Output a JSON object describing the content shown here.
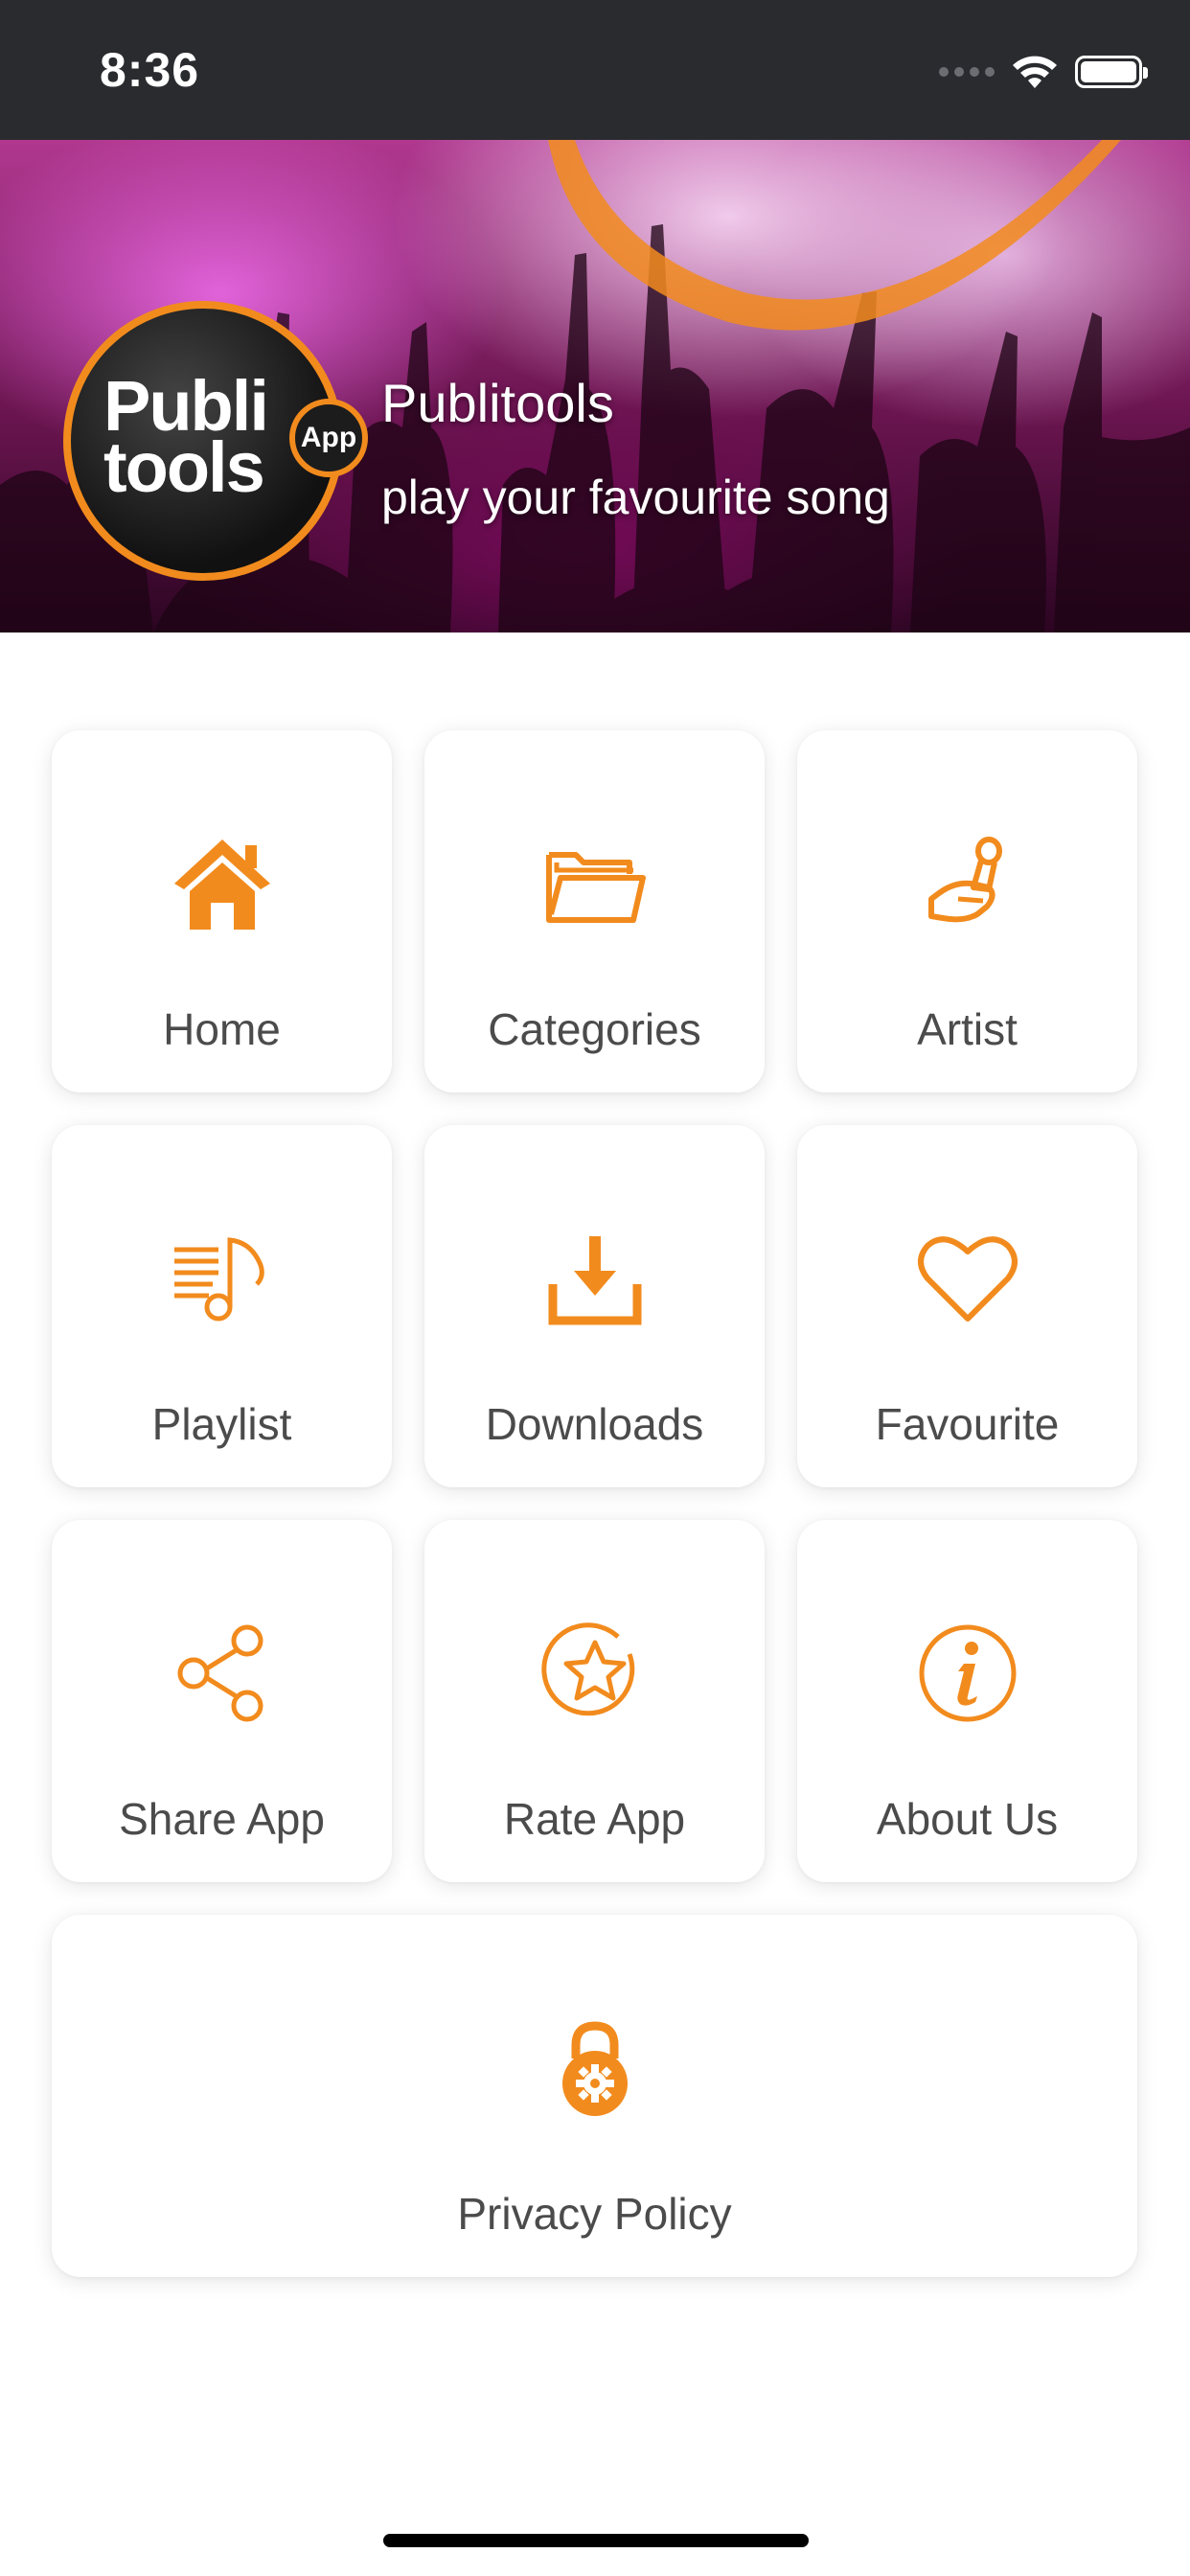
{
  "status_bar": {
    "time": "8:36"
  },
  "header": {
    "logo_text_line1": "Publi",
    "logo_text_line2": "tools",
    "logo_badge": "App",
    "title": "Publitools",
    "subtitle": "play your favourite song"
  },
  "menu": {
    "items": [
      {
        "label": "Home",
        "icon": "home-icon"
      },
      {
        "label": "Categories",
        "icon": "folder-icon"
      },
      {
        "label": "Artist",
        "icon": "microphone-hand-icon"
      },
      {
        "label": "Playlist",
        "icon": "playlist-icon"
      },
      {
        "label": "Downloads",
        "icon": "download-icon"
      },
      {
        "label": "Favourite",
        "icon": "heart-icon"
      },
      {
        "label": "Share App",
        "icon": "share-icon"
      },
      {
        "label": "Rate App",
        "icon": "star-icon"
      },
      {
        "label": "About Us",
        "icon": "info-icon"
      },
      {
        "label": "Privacy Policy",
        "icon": "lock-gear-icon"
      }
    ]
  },
  "colors": {
    "accent": "#f28b1d",
    "status_bar": "#2a2b2f",
    "label_text": "#4b4b4b"
  }
}
